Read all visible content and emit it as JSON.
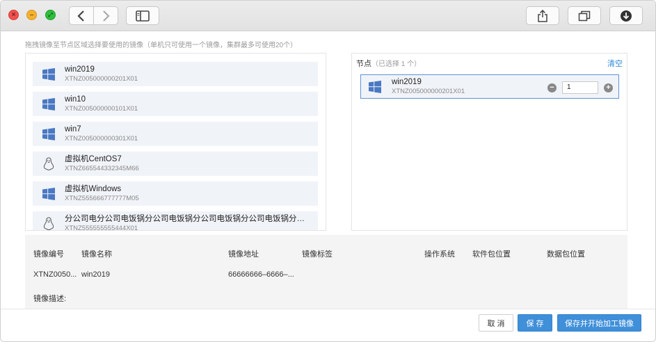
{
  "window": {
    "controls": {
      "close_glyph": "×",
      "minimize_glyph": "–",
      "zoom_glyph": "⤢"
    },
    "toolbar_icons": [
      "chevron-left-icon",
      "chevron-right-icon",
      "sidebar-icon",
      "share-icon",
      "duplicate-icon",
      "download-icon"
    ]
  },
  "hint": "拖拽镜像至节点区域选择要使用的镜像（单机只可使用一个镜像，集群最多可使用20个）",
  "images": [
    {
      "name": "win2019",
      "code": "XTNZ005000000201X01",
      "os": "windows"
    },
    {
      "name": "win10",
      "code": "XTNZ005000000101X01",
      "os": "windows"
    },
    {
      "name": "win7",
      "code": "XTNZ005000000301X01",
      "os": "windows"
    },
    {
      "name": "虚拟机CentOS7",
      "code": "XTNZ665544332345M66",
      "os": "linux"
    },
    {
      "name": "虚拟机Windows",
      "code": "XTNZ555666777777M05",
      "os": "windows"
    },
    {
      "name": "分公司电分公司电饭锅分公司电饭锅分公司电饭锅分公司电饭锅分公司...",
      "code": "XTNZ555555555444X01",
      "os": "linux"
    }
  ],
  "node": {
    "title": "节点",
    "subtitle": "（已选择 1 个）",
    "clear_label": "清空",
    "selected": {
      "name": "win2019",
      "code": "XTNZ005000000201X01",
      "os": "windows",
      "quantity": "1"
    },
    "minus_glyph": "−",
    "plus_glyph": "+"
  },
  "detail": {
    "headers": [
      "镜像编号",
      "镜像名称",
      "镜像地址",
      "镜像标签",
      "操作系统",
      "软件包位置",
      "数据包位置"
    ],
    "values": [
      "XTNZ0050...",
      "win2019",
      "66666666–6666–...",
      "",
      "",
      "",
      ""
    ],
    "description_label": "镜像描述:"
  },
  "footer": {
    "cancel_label": "取 消",
    "save_label": "保 存",
    "save_process_label": "保存并开始加工镜像"
  },
  "colors": {
    "accent": "#3f8fd9",
    "link": "#2a86d8",
    "windows_icon": "#4a78c2",
    "list_bg": "#f0f3f8",
    "selected_border": "#5b95d6"
  }
}
